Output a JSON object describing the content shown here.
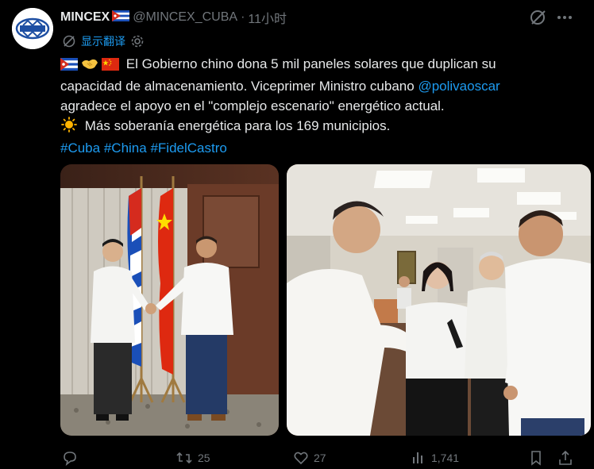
{
  "account": {
    "display_name": "MINCEX",
    "handle": "@MINCEX_CUBA",
    "separator": "·",
    "time": "11小时"
  },
  "translate": {
    "label": "显示翻译"
  },
  "post": {
    "line1": "El Gobierno chino dona 5 mil paneles solares que duplican su",
    "line2": "capacidad de almacenamiento. Viceprimer Ministro cubano",
    "mention": "@polivaoscar",
    "line3": "agradece el apoyo en el \"complejo escenario\" energético actual.",
    "line4": "Más soberanía energética para los 169 municipios.",
    "hashtags": [
      "#Cuba",
      "#China",
      "#FidelCastro"
    ]
  },
  "stats": {
    "retweets": "25",
    "likes": "27",
    "views": "1,741"
  },
  "colors": {
    "background": "#000000",
    "text": "#e7e9ea",
    "muted": "#71767b",
    "link": "#1d9bf0"
  },
  "icons": [
    "logo-icon",
    "cuba-flag-icon",
    "handshake-icon",
    "china-flag-icon",
    "sun-icon",
    "translate-icon",
    "settings-icon",
    "grok-icon",
    "more-icon",
    "reply-icon",
    "retweet-icon",
    "like-icon",
    "views-icon",
    "bookmark-icon",
    "share-icon"
  ]
}
